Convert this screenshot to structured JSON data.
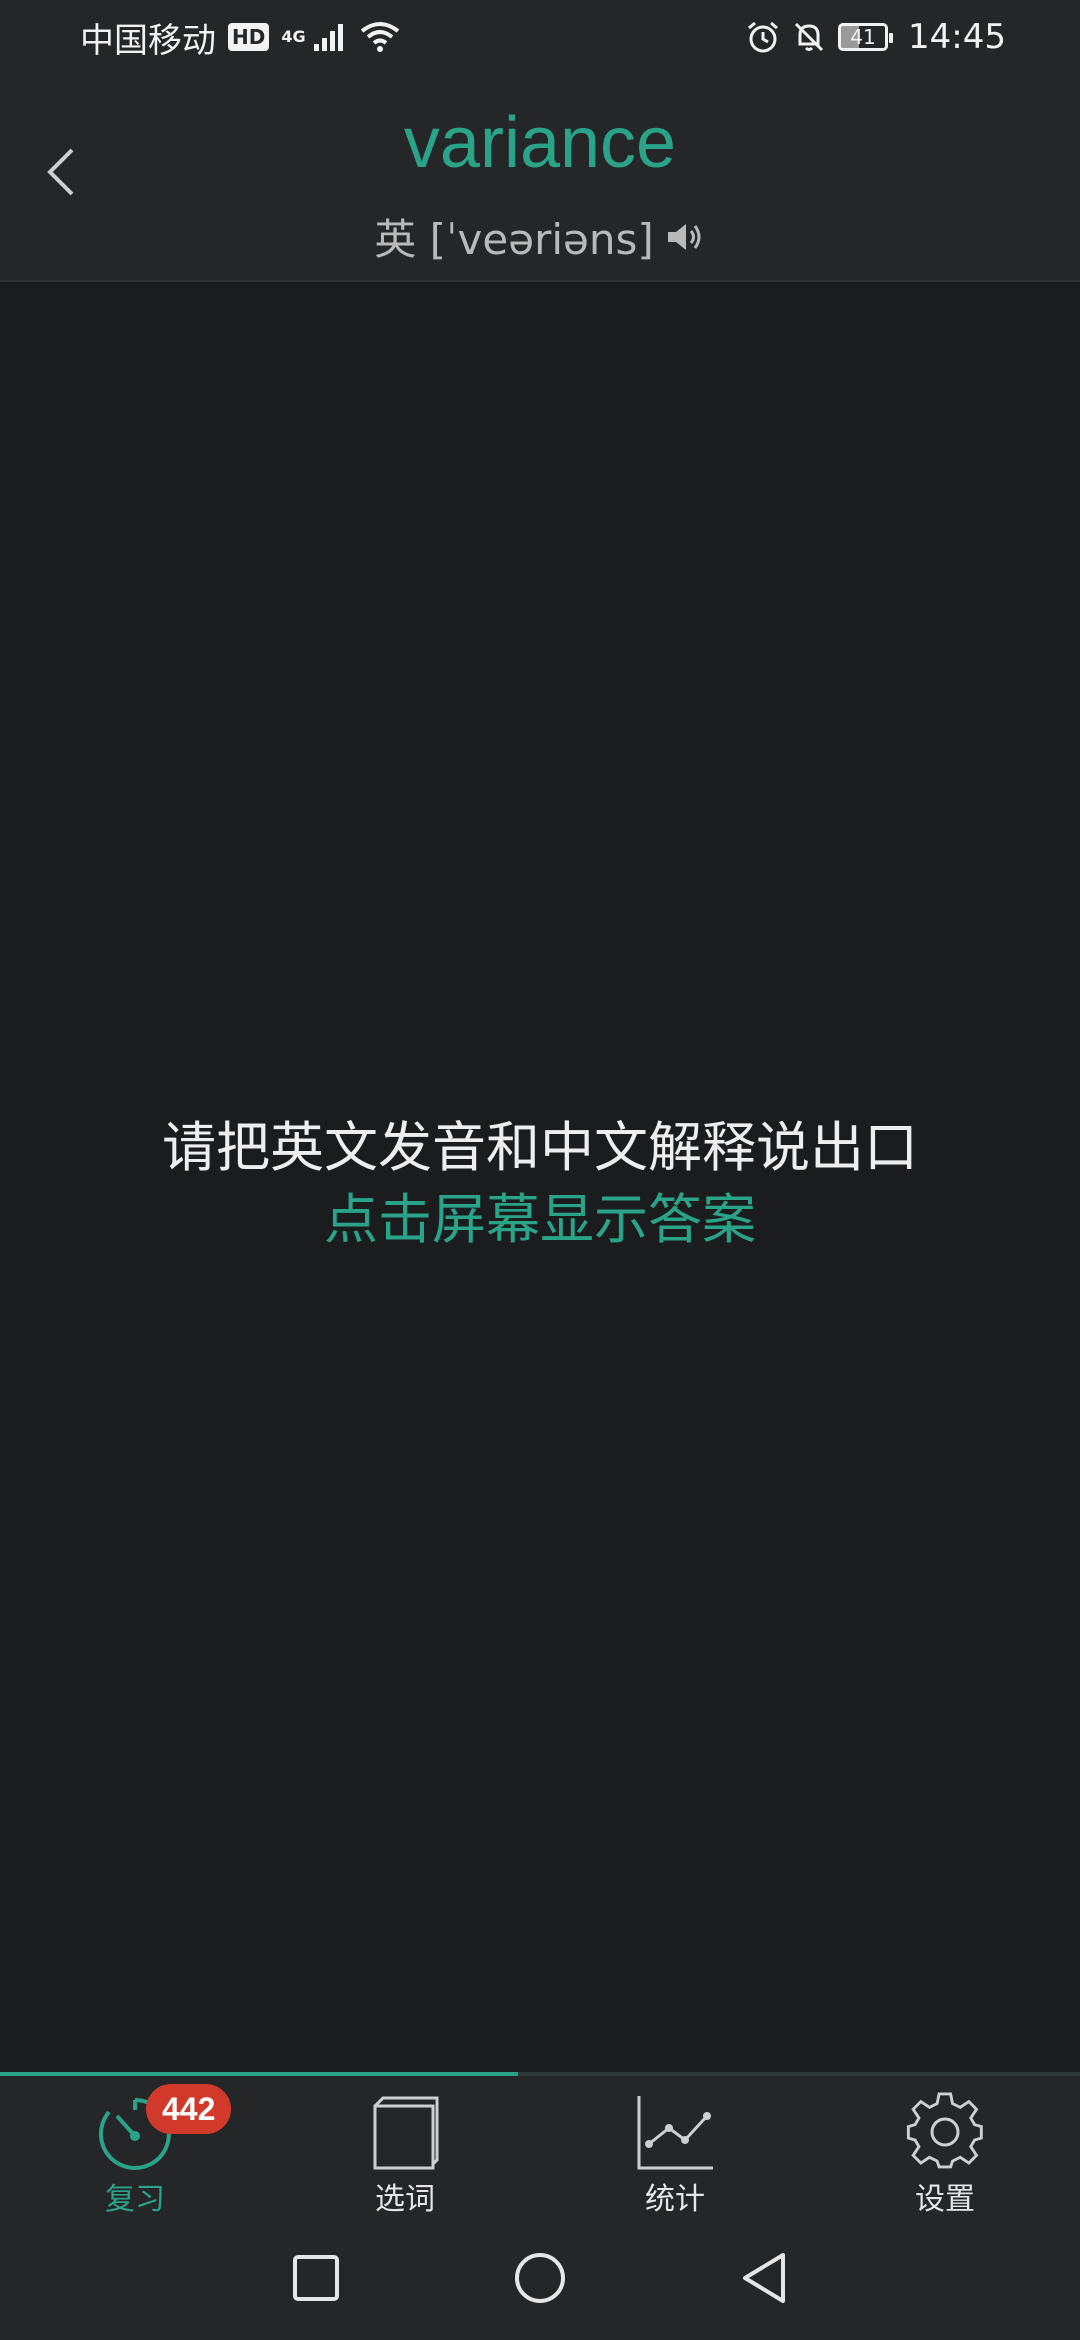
{
  "status_bar": {
    "carrier": "中国移动",
    "hd": "HD",
    "network": "4G",
    "battery": "41",
    "time": "14:45"
  },
  "header": {
    "word": "variance",
    "phonetic": "英 [ˈveəriəns]"
  },
  "main": {
    "prompt": "请把英文发音和中文解释说出口",
    "tap_hint": "点击屏幕显示答案"
  },
  "progress": {
    "fraction": 0.48
  },
  "nav": {
    "items": [
      {
        "label": "复习",
        "icon": "review-timer-icon",
        "badge": "442",
        "active": true
      },
      {
        "label": "选词",
        "icon": "book-icon"
      },
      {
        "label": "统计",
        "icon": "line-chart-icon"
      },
      {
        "label": "设置",
        "icon": "gear-icon"
      }
    ]
  },
  "colors": {
    "accent": "#2aa488",
    "badge": "#d13a2a",
    "background": "#1b1c1e",
    "bar": "#252628"
  }
}
